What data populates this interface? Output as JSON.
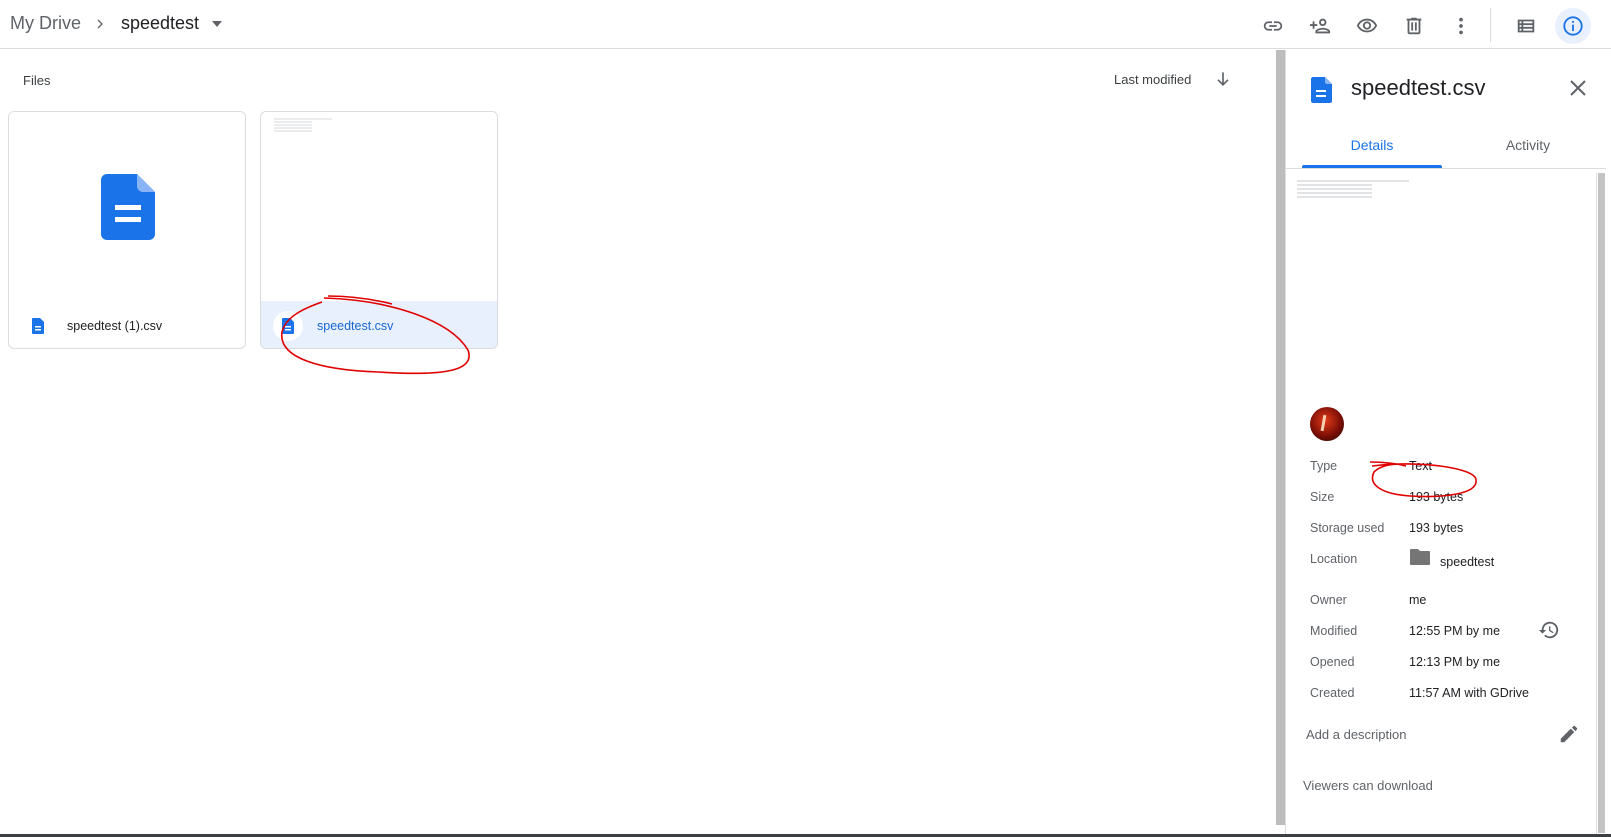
{
  "header": {
    "breadcrumb_root": "My Drive",
    "breadcrumb_current": "speedtest",
    "tools": [
      "link-icon",
      "person-add-icon",
      "eye-icon",
      "trash-icon",
      "more-vert-icon",
      "list-view-icon",
      "info-icon"
    ]
  },
  "main": {
    "section_label": "Files",
    "sort_label": "Last modified",
    "files": [
      {
        "name": "speedtest (1).csv",
        "selected": false
      },
      {
        "name": "speedtest.csv",
        "selected": true
      }
    ]
  },
  "details": {
    "title": "speedtest.csv",
    "tabs": [
      "Details",
      "Activity"
    ],
    "active_tab": "Details",
    "rows": {
      "type": {
        "label": "Type",
        "value": "Text"
      },
      "size": {
        "label": "Size",
        "value": "193 bytes"
      },
      "storage": {
        "label": "Storage used",
        "value": "193 bytes"
      },
      "location": {
        "label": "Location",
        "value": "speedtest"
      },
      "owner": {
        "label": "Owner",
        "value": "me"
      },
      "modified": {
        "label": "Modified",
        "value": "12:55 PM by me"
      },
      "opened": {
        "label": "Opened",
        "value": "12:13 PM by me"
      },
      "created": {
        "label": "Created",
        "value": "11:57 AM with GDrive"
      }
    },
    "description_placeholder": "Add a description",
    "viewers_text": "Viewers can download"
  },
  "colors": {
    "accent": "#1a73e8",
    "annotation": "#e00000",
    "selected_bg": "#e8f0fe"
  }
}
